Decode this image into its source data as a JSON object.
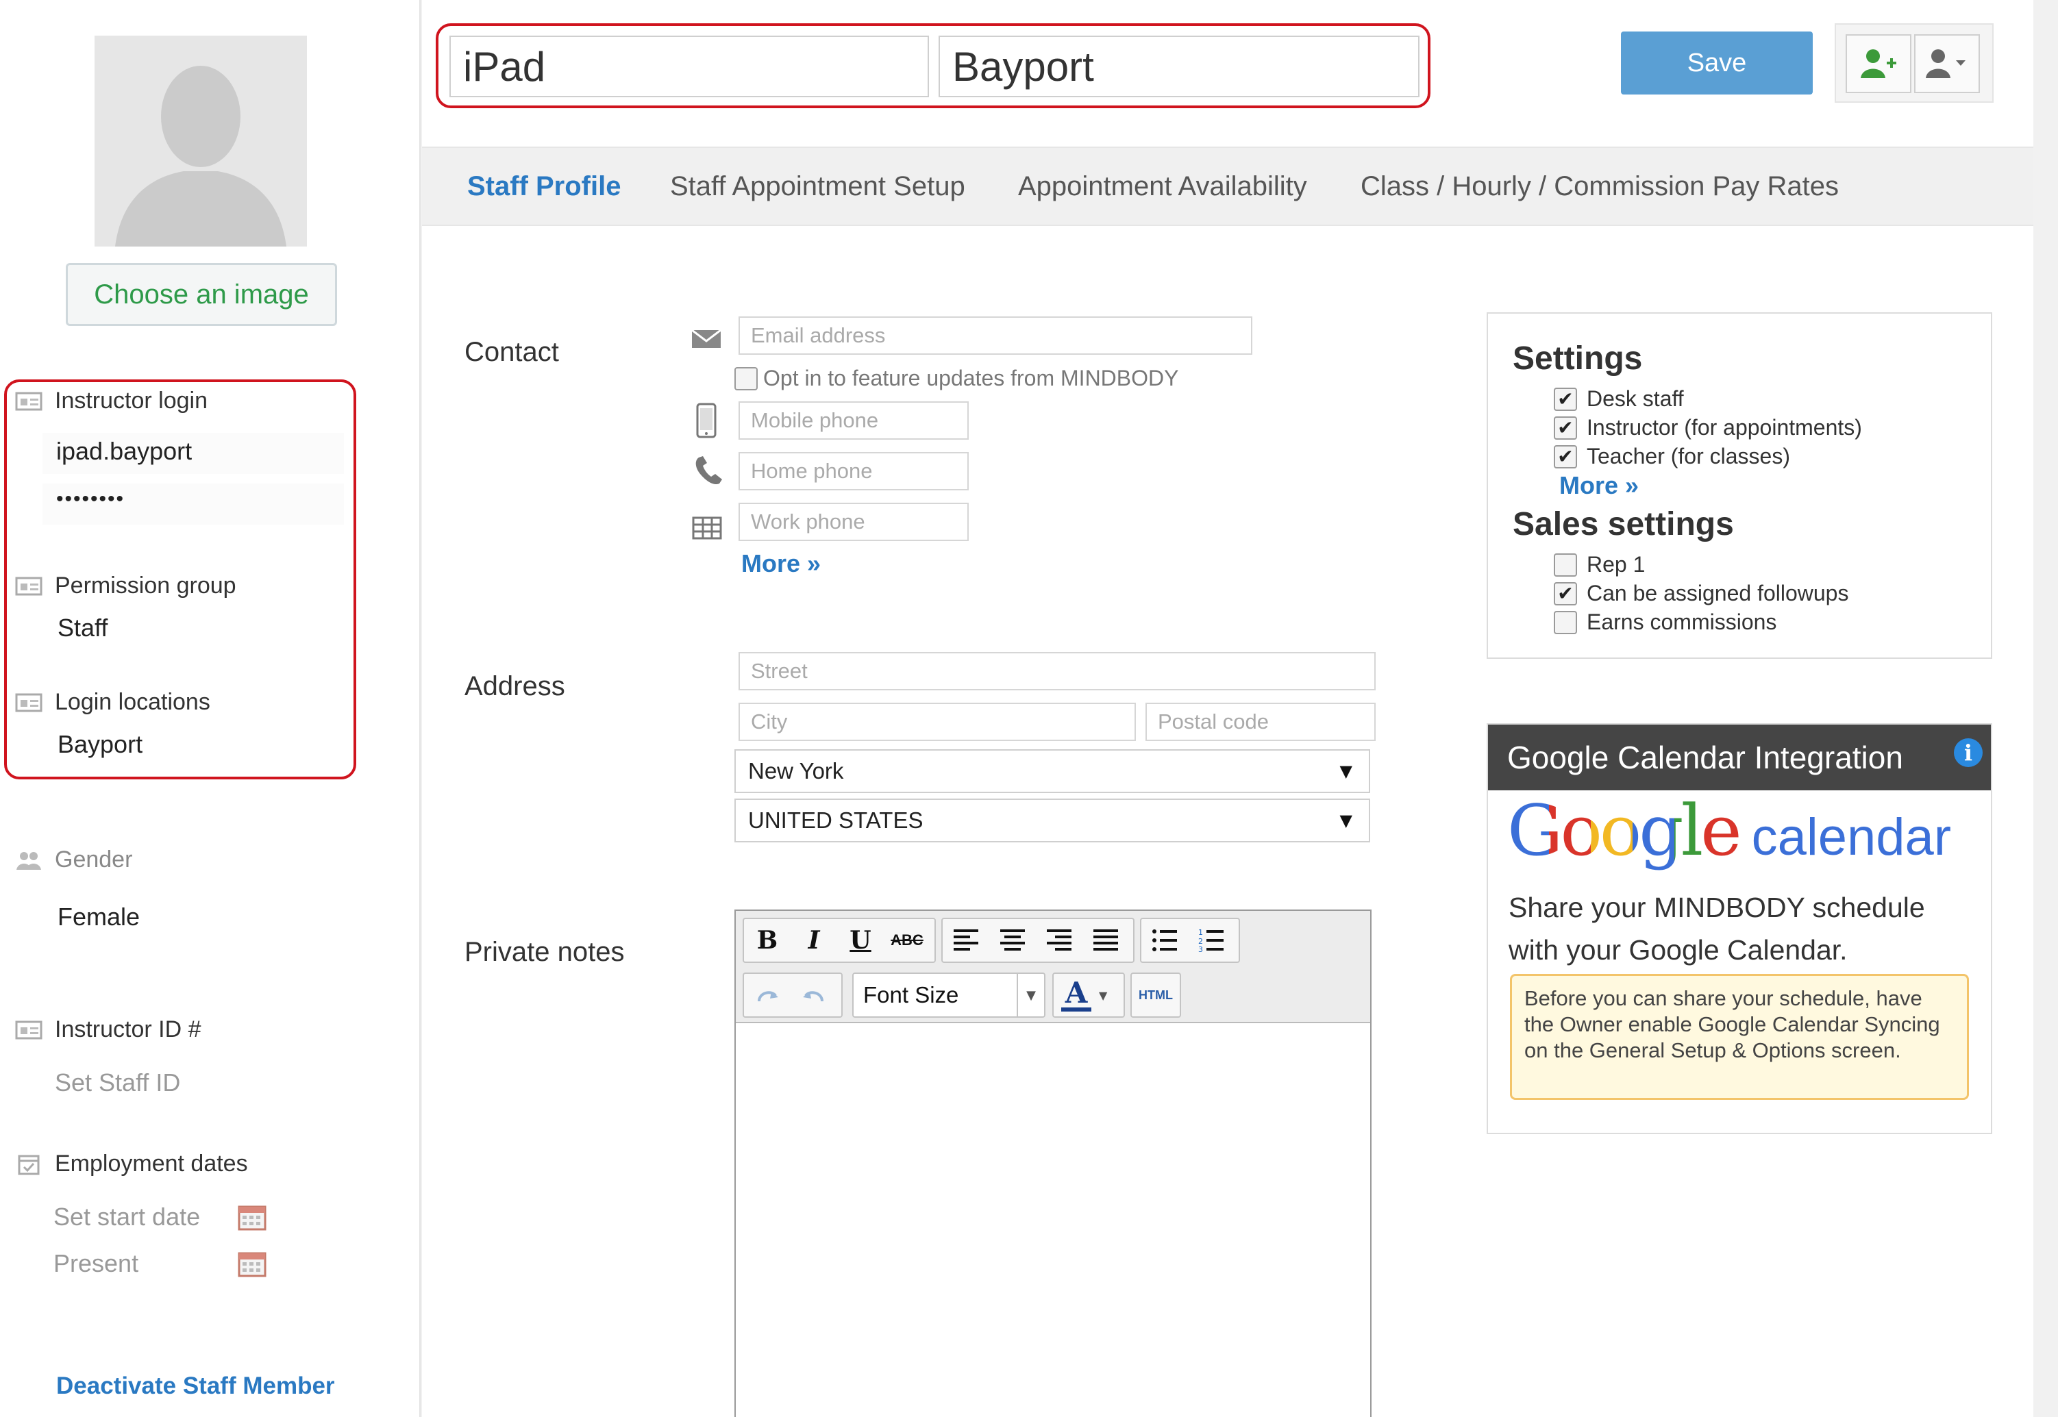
{
  "sidebar": {
    "choose_image": "Choose an image",
    "instructor_login_label": "Instructor login",
    "username": "ipad.bayport",
    "password_masked": "••••••••",
    "permission_group_label": "Permission group",
    "permission_group_value": "Staff",
    "login_locations_label": "Login locations",
    "login_locations_value": "Bayport",
    "gender_label": "Gender",
    "gender_value": "Female",
    "instructor_id_label": "Instructor ID #",
    "instructor_id_value": "Set Staff ID",
    "employment_dates_label": "Employment dates",
    "start_date": "Set start date",
    "end_date": "Present",
    "deactivate": "Deactivate Staff Member"
  },
  "header": {
    "first_name": "iPad",
    "last_name": "Bayport",
    "save_label": "Save"
  },
  "tabs": [
    {
      "label": "Staff Profile",
      "active": true
    },
    {
      "label": "Staff Appointment Setup",
      "active": false
    },
    {
      "label": "Appointment Availability",
      "active": false
    },
    {
      "label": "Class / Hourly / Commission Pay Rates",
      "active": false
    }
  ],
  "contact": {
    "label": "Contact",
    "email_placeholder": "Email address",
    "opt_in_label": "Opt in to feature updates from MINDBODY",
    "opt_in_checked": false,
    "mobile_placeholder": "Mobile phone",
    "home_placeholder": "Home phone",
    "work_placeholder": "Work phone",
    "more": "More »"
  },
  "address": {
    "label": "Address",
    "street_placeholder": "Street",
    "city_placeholder": "City",
    "postal_placeholder": "Postal code",
    "state": "New York",
    "country": "UNITED STATES"
  },
  "notes": {
    "label": "Private notes",
    "font_size_label": "Font Size",
    "html_label": "HTML"
  },
  "settings": {
    "title": "Settings",
    "items": [
      {
        "label": "Desk staff",
        "checked": true
      },
      {
        "label": "Instructor (for appointments)",
        "checked": true
      },
      {
        "label": "Teacher (for classes)",
        "checked": true
      }
    ],
    "more": "More »",
    "sales_title": "Sales settings",
    "sales_items": [
      {
        "label": "Rep 1",
        "checked": false
      },
      {
        "label": "Can be assigned followups",
        "checked": true
      },
      {
        "label": "Earns commissions",
        "checked": false
      }
    ]
  },
  "gcal": {
    "title": "Google Calendar Integration",
    "logo_google": "Google",
    "logo_calendar": "calendar",
    "description": "Share your MINDBODY schedule with your Google Calendar.",
    "warning": "Before you can share your schedule, have the Owner enable Google Calendar Syncing on the General Setup & Options screen."
  },
  "colors": {
    "accent_blue": "#2a79c2",
    "save_blue": "#5a9fd4",
    "highlight_red": "#d0141e",
    "green_text": "#2e9a49"
  }
}
